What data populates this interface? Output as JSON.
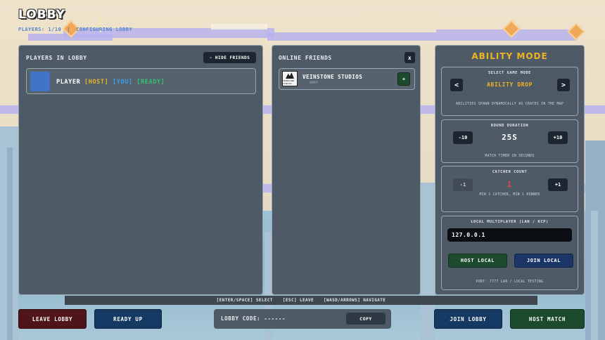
{
  "header": {
    "title": "LOBBY",
    "players_text": "PLAYERS: 1/10",
    "separator": "|",
    "status_text": "CONFIGURING LOBBY"
  },
  "players_panel": {
    "title": "PLAYERS IN LOBBY",
    "hide_friends_label": "- HIDE FRIENDS",
    "player": {
      "name": "PLAYER",
      "host_tag": "[HOST]",
      "you_tag": "[YOU]",
      "ready_tag": "[READY]"
    }
  },
  "friends_panel": {
    "title": "ONLINE FRIENDS",
    "close_label": "x",
    "friend": {
      "logo_text": "VEINSTONE STUDIOS",
      "name": "VEINSTONE STUDIOS",
      "status": "AWAY",
      "invite_label": "+"
    }
  },
  "settings_panel": {
    "title": "ABILITY MODE",
    "game_mode": {
      "label": "SELECT GAME MODE",
      "prev_label": "<",
      "next_label": ">",
      "value": "ABILITY DROP",
      "description": "ABILITIES SPAWN DYNAMICALLY AS CRATES IN THE MAP"
    },
    "round_duration": {
      "label": "ROUND DURATION",
      "dec_label": "-10",
      "inc_label": "+10",
      "value": "25S",
      "note": "MATCH TIMER IN SECONDS"
    },
    "catcher_count": {
      "label": "CATCHER COUNT",
      "dec_label": "-1",
      "inc_label": "+1",
      "value": "1",
      "note": "MIN 1 CATCHER, MIN 1 RUNNER"
    },
    "local_multiplayer": {
      "label": "LOCAL MULTIPLAYER (LAN / KCP)",
      "ip_value": "127.0.0.1",
      "host_label": "HOST LOCAL",
      "join_label": "JOIN LOCAL",
      "note": "PORT: 7777  LAN / LOCAL TESTING"
    }
  },
  "hints": {
    "select": "[ENTER/SPACE] SELECT",
    "leave": "[ESC] LEAVE",
    "navigate": "[WASD/ARROWS] NAVIGATE"
  },
  "bottom_bar": {
    "leave_label": "LEAVE LOBBY",
    "ready_label": "READY UP",
    "code_label": "LOBBY CODE: ------",
    "copy_label": "COPY",
    "join_label": "JOIN LOBBY",
    "host_label": "HOST MATCH"
  },
  "colors": {
    "panel": "#4e5a66",
    "gold": "#f0b422",
    "host_green": "#1c4a2d",
    "navy": "#143a63",
    "leave_red": "#4f1518"
  }
}
